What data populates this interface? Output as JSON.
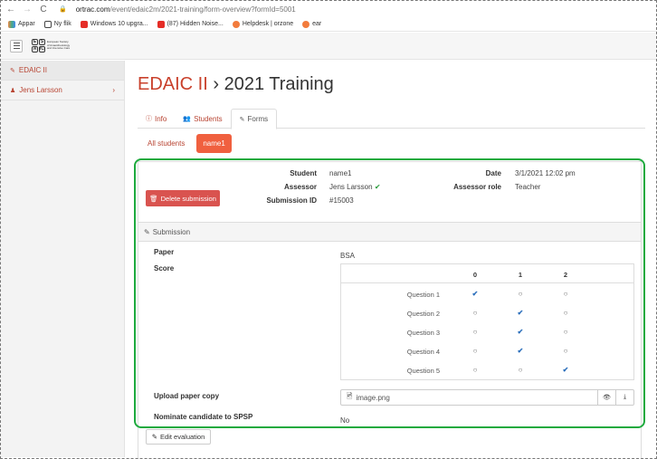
{
  "browser": {
    "back": "←",
    "forward": "→",
    "reload": "C",
    "url_host": "ortrac.com",
    "url_path": "/event/edaic2m/2021-training/form-overview?formId=5001",
    "bookmarks": [
      {
        "label": "Appar",
        "icon": "apps-icon"
      },
      {
        "label": "Ny flik",
        "icon": "globe-icon"
      },
      {
        "label": "Windows 10 upgra...",
        "icon": "youtube-icon"
      },
      {
        "label": "(87) Hidden Noise...",
        "icon": "youtube-icon"
      },
      {
        "label": "Helpdesk | orzone",
        "icon": "hubspot-icon"
      },
      {
        "label": "ear",
        "icon": "hubspot-icon"
      }
    ]
  },
  "logo": {
    "letters": [
      "E",
      "S",
      "A",
      "IC"
    ],
    "text": "European Society of Anaesthesiology and Intensive Care"
  },
  "sidebar": {
    "items": [
      {
        "label": "EDAIC II",
        "icon": "edit-icon"
      },
      {
        "label": "Jens Larsson",
        "icon": "user-icon",
        "chevron": "›"
      }
    ]
  },
  "page": {
    "title_accent": "EDAIC II",
    "title_rest": " › 2021 Training"
  },
  "tabs": [
    {
      "label": "Info",
      "icon": "ⓘ"
    },
    {
      "label": "Students",
      "icon": "👥"
    },
    {
      "label": "Forms",
      "icon": "✎"
    }
  ],
  "subtabs": [
    "All students",
    "name1"
  ],
  "submission": {
    "student_label": "Student",
    "student": "name1",
    "assessor_label": "Assessor",
    "assessor": "Jens Larsson",
    "submission_id_label": "Submission ID",
    "submission_id": "#15003",
    "date_label": "Date",
    "date": "3/1/2021 12:02 pm",
    "assessor_role_label": "Assessor role",
    "assessor_role": "Teacher",
    "delete_label": "Delete submission",
    "section_title": "Submission"
  },
  "form": {
    "paper_label": "Paper",
    "paper_value": "BSA",
    "score_label": "Score",
    "score_columns": [
      "0",
      "1",
      "2"
    ],
    "questions": [
      {
        "label": "Question 1",
        "selected": 0
      },
      {
        "label": "Question 2",
        "selected": 1
      },
      {
        "label": "Question 3",
        "selected": 1
      },
      {
        "label": "Question 4",
        "selected": 1
      },
      {
        "label": "Question 5",
        "selected": 2
      }
    ],
    "upload_label": "Upload paper copy",
    "upload_file": "image.png",
    "nominate_label": "Nominate candidate to SPSP",
    "nominate_value": "No",
    "edit_label": "Edit evaluation"
  },
  "colors": {
    "accent": "#c9412c",
    "highlight_box": "#1eaa3e",
    "delete": "#d9534f",
    "pill": "#f0603f"
  }
}
